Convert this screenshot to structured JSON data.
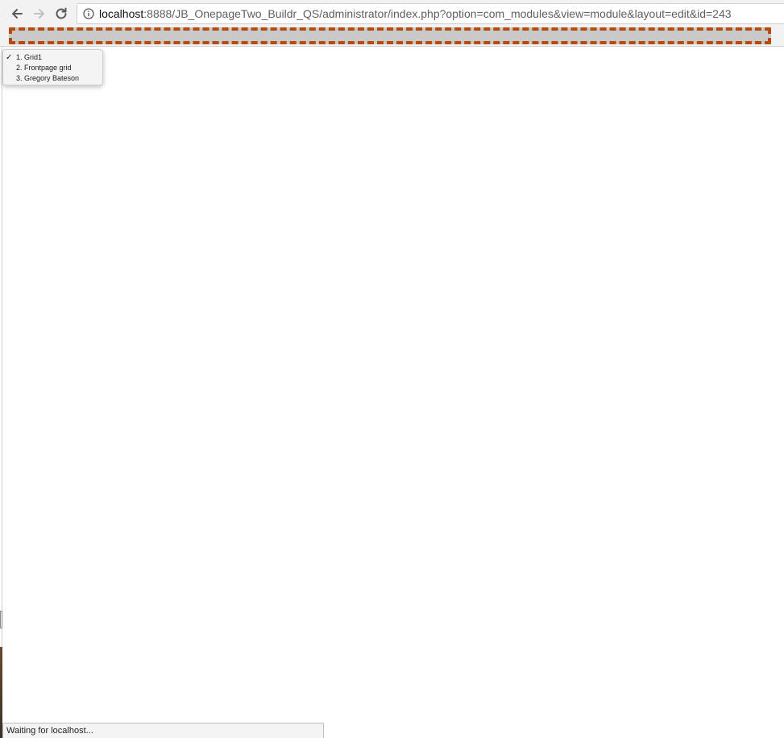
{
  "toolbar": {
    "back_icon": "arrow-left-icon",
    "forward_icon": "arrow-right-icon",
    "reload_icon": "reload-icon",
    "info_icon": "info-icon",
    "url_host": "localhost",
    "url_rest": ":8888/JB_OnepageTwo_Buildr_QS/administrator/index.php?option=com_modules&view=module&layout=edit&id=243"
  },
  "popup_menu": {
    "selected_mark": "✓",
    "items": [
      {
        "label": "1. Grid1",
        "selected": true
      },
      {
        "label": "2. Frontpage grid",
        "selected": false
      },
      {
        "label": "3. Gregory Bateson",
        "selected": false
      }
    ]
  },
  "status": {
    "text": "Waiting for localhost..."
  },
  "colors": {
    "highlight_border": "#b84a0e",
    "highlight_fill": "#c9c9c9",
    "toolbar_bg": "#f2f2f2"
  }
}
